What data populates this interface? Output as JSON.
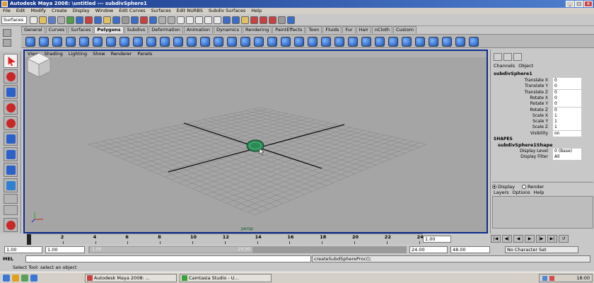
{
  "window": {
    "title": "Autodesk Maya 2008: \\untitled   ---   subdivSphere1"
  },
  "menubar": {
    "items": [
      "File",
      "Edit",
      "Modify",
      "Create",
      "Display",
      "Window",
      "Edit Curves",
      "Surfaces",
      "Edit NURBS",
      "Subdiv Surfaces",
      "Help"
    ]
  },
  "statusline": {
    "mode": "Surfaces"
  },
  "shelf": {
    "tabs": [
      "General",
      "Curves",
      "Surfaces",
      "Polygons",
      "Subdivs",
      "Deformation",
      "Animation",
      "Dynamics",
      "Rendering",
      "PaintEffects",
      "Toon",
      "Fluids",
      "Fur",
      "Hair",
      "nCloth",
      "Custom"
    ],
    "active_tab": "Polygons"
  },
  "viewport": {
    "menu": [
      "View",
      "Shading",
      "Lighting",
      "Show",
      "Renderer",
      "Panels"
    ],
    "camera": "persp"
  },
  "channel_box": {
    "menu": [
      "Channels",
      "Object"
    ],
    "object_name": "subdivSphere1",
    "attributes": [
      {
        "name": "Translate X",
        "value": "0"
      },
      {
        "name": "Translate Y",
        "value": "0"
      },
      {
        "name": "Translate Z",
        "value": "0"
      },
      {
        "name": "Rotate X",
        "value": "0"
      },
      {
        "name": "Rotate Y",
        "value": "0"
      },
      {
        "name": "Rotate Z",
        "value": "0"
      },
      {
        "name": "Scale X",
        "value": "1"
      },
      {
        "name": "Scale Y",
        "value": "1"
      },
      {
        "name": "Scale Z",
        "value": "1"
      },
      {
        "name": "Visibility",
        "value": "on"
      }
    ],
    "shapes_header": "SHAPES",
    "shape_name": "subdivSphere1Shape",
    "shape_attributes": [
      {
        "name": "Display Level",
        "value": "0 (Base)"
      },
      {
        "name": "Display Filter",
        "value": "All"
      }
    ]
  },
  "layer_editor": {
    "radio_display": "Display",
    "radio_render": "Render",
    "selected": "Display",
    "menu": [
      "Layers",
      "Options",
      "Help"
    ]
  },
  "time_slider": {
    "ticks": [
      "2",
      "4",
      "6",
      "8",
      "10",
      "12",
      "14",
      "16",
      "18",
      "20",
      "22",
      "24"
    ],
    "current_time": "1.00"
  },
  "range_slider": {
    "start_time": "1.00",
    "playback_start": "1.00",
    "range_label_start": "1.00",
    "range_label_end": "24.00",
    "playback_end": "24.00",
    "end_time": "48.00",
    "character_set": "No Character Set"
  },
  "command_line": {
    "label": "MEL",
    "input": "",
    "output": "createSubdSphereProc();"
  },
  "help_line": {
    "text": "Select Tool: select an object"
  },
  "taskbar": {
    "buttons": [
      "Autodesk Maya 2008: ...",
      "Camtasia Studio - U..."
    ],
    "clock": "18:00"
  }
}
